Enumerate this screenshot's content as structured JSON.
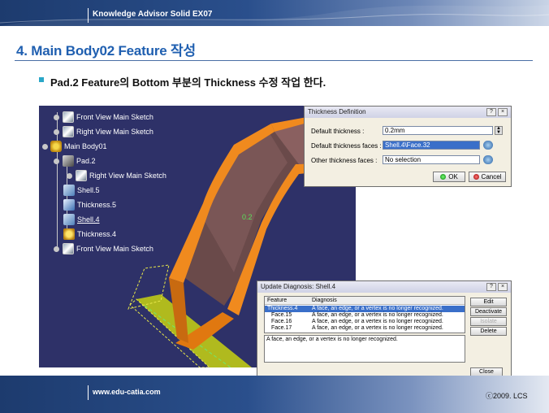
{
  "header": {
    "title": "Knowledge Advisor Solid EX07"
  },
  "slide": {
    "title": "4. Main Body02 Feature 작성",
    "subtitle": "Pad.2 Feature의 Bottom 부분의  Thickness 수정 작업 한다."
  },
  "tree": {
    "items": [
      {
        "label": "Front View Main Sketch",
        "icon": "sketch-icon"
      },
      {
        "label": "Right View Main Sketch",
        "icon": "sketch-icon"
      },
      {
        "label": "Main Body01",
        "icon": "body-icon"
      },
      {
        "label": "Pad.2",
        "icon": "pad-icon"
      },
      {
        "label": "Right View Main Sketch",
        "icon": "sketch-icon"
      },
      {
        "label": "Shell.5",
        "icon": "shell-icon"
      },
      {
        "label": "Thickness.5",
        "icon": "thickness-icon"
      },
      {
        "label": "Shell.4",
        "icon": "shell-icon"
      },
      {
        "label": "Thickness.4",
        "icon": "thickness-warning-icon"
      },
      {
        "label": "Front View Main Sketch",
        "icon": "sketch-icon"
      }
    ]
  },
  "viewport": {
    "dimension_label": "0.2"
  },
  "thickness_dialog": {
    "title": "Thickness Definition",
    "default_thickness_label": "Default thickness :",
    "default_thickness_value": "0.2mm",
    "default_faces_label": "Default thickness faces :",
    "default_faces_value": "Shell.4\\Face.32",
    "other_faces_label": "Other thickness faces :",
    "other_faces_value": "No selection",
    "ok_label": "OK",
    "cancel_label": "Cancel"
  },
  "diagnosis_dialog": {
    "title": "Update Diagnosis: Shell.4",
    "columns": [
      "Feature",
      "Diagnosis"
    ],
    "rows": [
      {
        "feature": "Thickness.4",
        "diagnosis": "A face, an edge, or a vertex is no longer recognized."
      },
      {
        "feature": "Face.15",
        "diagnosis": "A face, an edge, or a vertex is no longer recognized."
      },
      {
        "feature": "Face.16",
        "diagnosis": "A face, an edge, or a vertex is no longer recognized."
      },
      {
        "feature": "Face.17",
        "diagnosis": "A face, an edge, or a vertex is no longer recognized."
      }
    ],
    "message": "A face, an edge, or a vertex is no longer recognized.",
    "buttons": {
      "edit": "Edit",
      "deactivate": "Deactivate",
      "isolate": "Isolate",
      "delete": "Delete",
      "close": "Close"
    }
  },
  "footer": {
    "url": "www.edu-catia.com",
    "copyright": "ⓒ2009. LCS"
  },
  "colors": {
    "accent": "#1f5fb0",
    "viewport_bg": "#2e3168",
    "part_orange": "#f08a1e",
    "highlight": "#3a6fc9"
  }
}
